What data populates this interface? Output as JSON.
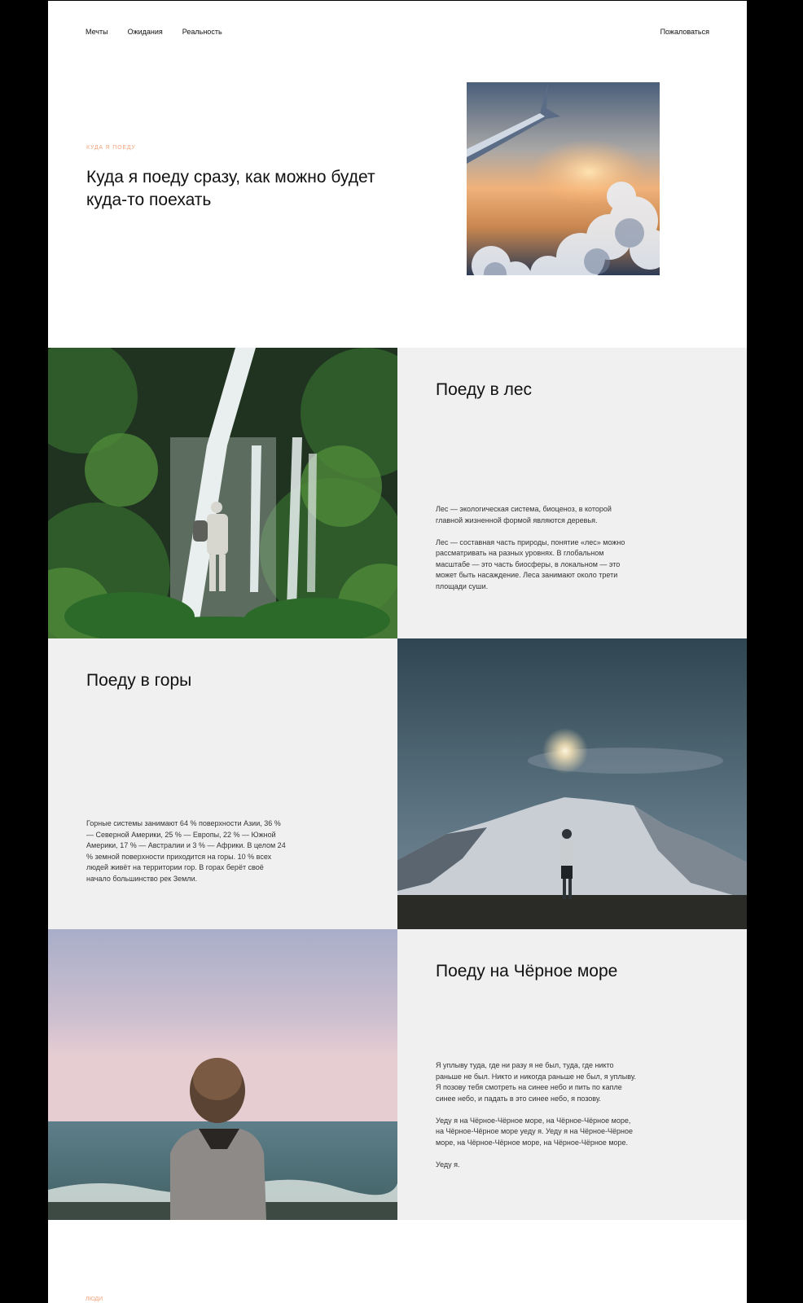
{
  "nav": {
    "items": [
      {
        "label": "Мечты"
      },
      {
        "label": "Ожидания"
      },
      {
        "label": "Реальность"
      }
    ],
    "report_label": "Пожаловаться"
  },
  "hero": {
    "eyebrow": "Куда я поеду",
    "title": "Куда я поеду сразу, как можно будет куда-то поехать"
  },
  "sections": {
    "forest": {
      "title": "Поеду в лес",
      "paragraphs": [
        "Лес — экологическая система, биоценоз, в которой главной жизненной формой являются деревья.",
        "Лес — составная часть природы, понятие «лес» можно рассматривать на разных уровнях. В глобальном масштабе — это часть биосферы, в локальном — это может быть насаждение. Леса занимают около трети площади суши."
      ]
    },
    "mountains": {
      "title": "Поеду в горы",
      "paragraphs": [
        "Горные системы занимают 64 % поверхности Азии, 36 % — Северной Америки, 25 % — Европы, 22 % — Южной Америки, 17 % — Австралии и 3 % — Африки. В целом 24 % земной поверхности приходится на горы. 10 % всех людей живёт на территории гор. В горах берёт своё начало большинство рек Земли."
      ]
    },
    "sea": {
      "title": "Поеду на Чёрное море",
      "paragraphs": [
        "Я уплыву туда, где ни разу я не был, туда, где никто раньше не был. Никто и никогда раньше не был, я уплыву. Я позову тебя смотреть на синее небо и пить по капле синее небо, и падать в это синее небо, я позову.",
        "Уеду я на Чёрное-Чёрное море, на Чёрное-Чёрное море, на Чёрное-Чёрное море уеду я. Уеду я на Чёрное-Чёрное море, на Чёрное-Чёрное море, на Чёрное-Чёрное море.",
        "Уеду я."
      ]
    }
  },
  "footer": {
    "eyebrow": "Люди"
  },
  "colors": {
    "accent": "#f2a47a",
    "panel": "#f0f0f0"
  }
}
